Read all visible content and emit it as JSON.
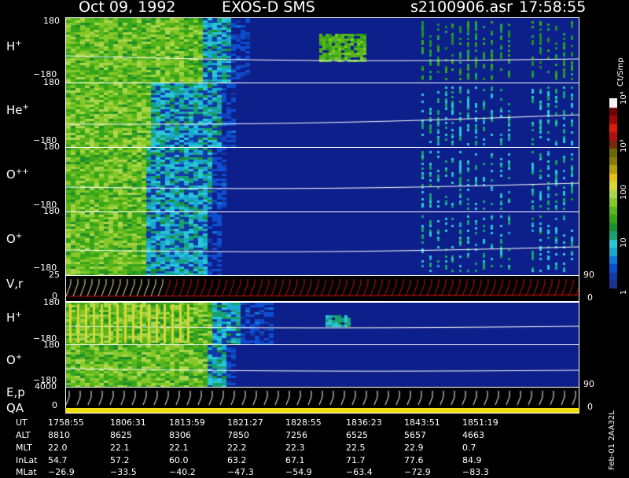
{
  "header": {
    "date": "Oct 09, 1992",
    "instrument": "EXOS-D SMS",
    "file": "s2100906.asr",
    "time": "17:58:55"
  },
  "panels": [
    {
      "id": "h",
      "label": "H",
      "charge": "+",
      "ymax": "180",
      "ymin": "−180"
    },
    {
      "id": "he",
      "label": "He",
      "charge": "+",
      "ymax": "180",
      "ymin": "−180"
    },
    {
      "id": "opp",
      "label": "O",
      "charge": "++",
      "ymax": "180",
      "ymin": "−180"
    },
    {
      "id": "o",
      "label": "O",
      "charge": "+",
      "ymax": "180",
      "ymin": "−180"
    },
    {
      "id": "vr",
      "label": "V,r",
      "ymax": "25",
      "ymin": "0",
      "rmax": "90",
      "rmin": "0"
    },
    {
      "id": "h2",
      "label": "H",
      "charge": "+",
      "ymax": "180",
      "ymin": "−180"
    },
    {
      "id": "o2",
      "label": "O",
      "charge": "+",
      "ymax": "180",
      "ymin": "−180"
    },
    {
      "id": "ep",
      "label": "E,p",
      "label2": "QA",
      "ymax": "4000",
      "ymin": "0",
      "rmax": "90",
      "rmin": "0"
    }
  ],
  "colorbar": {
    "unit": "Ct/Smp",
    "ticks": [
      {
        "value": 1,
        "label": "1"
      },
      {
        "value": 10,
        "label": "10"
      },
      {
        "value": 100,
        "label": "100"
      },
      {
        "value": 1000,
        "label": "10³"
      },
      {
        "value": 10000,
        "label": "10⁴"
      }
    ],
    "colors": [
      "#1f3088",
      "#123aa5",
      "#0d4ed0",
      "#0f77d8",
      "#18a8d0",
      "#2ac6d8",
      "#18a070",
      "#1e8e2a",
      "#36a51a",
      "#5ab51c",
      "#86c82a",
      "#aad64a",
      "#d6d838",
      "#e2c018",
      "#b4a010",
      "#8a7a08",
      "#6a6a06",
      "#7a2a08",
      "#b01010",
      "#d81e10",
      "#a00808",
      "#700404",
      "#f4f4f4"
    ]
  },
  "chart_data": {
    "type": "heatmap",
    "title": "Oct 09, 1992   EXOS-D SMS",
    "xlabel": "UT",
    "x": [
      "1758:55",
      "1806:31",
      "1813:59",
      "1821:27",
      "1828:55",
      "1836:23",
      "1843:51",
      "1851:19"
    ],
    "series": [
      {
        "name": "H+",
        "yrange": [
          -180,
          180
        ],
        "description": "count-rate spectrogram"
      },
      {
        "name": "He+",
        "yrange": [
          -180,
          180
        ]
      },
      {
        "name": "O++",
        "yrange": [
          -180,
          180
        ]
      },
      {
        "name": "O+",
        "yrange": [
          -180,
          180
        ]
      },
      {
        "name": "V,r",
        "yrange": [
          0,
          25
        ]
      },
      {
        "name": "H+",
        "yrange": [
          -180,
          180
        ]
      },
      {
        "name": "O+",
        "yrange": [
          -180,
          180
        ]
      },
      {
        "name": "E,p",
        "yrange": [
          0,
          4000
        ]
      }
    ],
    "colorscale": {
      "unit": "Ct/Smp",
      "log": true,
      "range": [
        1,
        10000
      ]
    }
  },
  "orbit": {
    "rows": [
      {
        "label": "UT",
        "values": [
          "1758:55",
          "1806:31",
          "1813:59",
          "1821:27",
          "1828:55",
          "1836:23",
          "1843:51",
          "1851:19"
        ]
      },
      {
        "label": "ALT",
        "values": [
          "8810",
          "8625",
          "8306",
          "7850",
          "7256",
          "6525",
          "5657",
          "4663"
        ]
      },
      {
        "label": "MLT",
        "values": [
          "22.0",
          "22.1",
          "22.1",
          "22.2",
          "22.3",
          "22.5",
          "22.9",
          "0.7"
        ]
      },
      {
        "label": "InLat",
        "values": [
          "54.7",
          "57.2",
          "60.0",
          "63.2",
          "67.1",
          "71.7",
          "77.6",
          "84.9"
        ]
      },
      {
        "label": "MLat",
        "values": [
          "−26.9",
          "−33.5",
          "−40.2",
          "−47.3",
          "−54.9",
          "−63.4",
          "−72.9",
          "−83.3"
        ]
      }
    ]
  },
  "footer_code": "Feb-01 2AA32L"
}
